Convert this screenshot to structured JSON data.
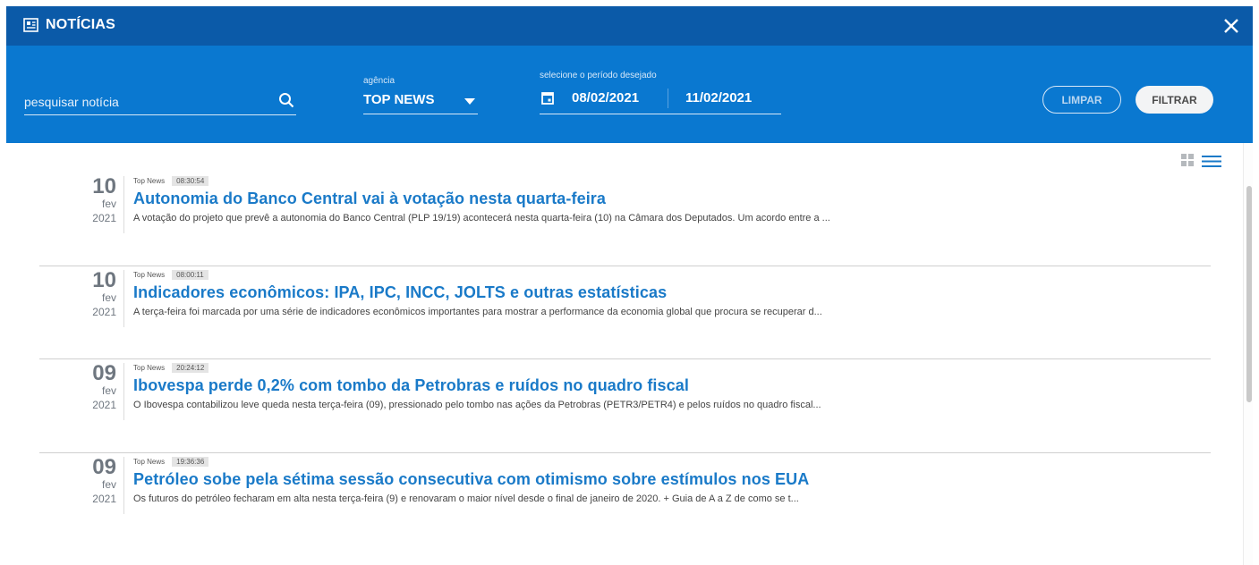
{
  "window": {
    "title": "NOTÍCIAS",
    "title_icon": "newspaper-icon",
    "close_icon": "close-icon"
  },
  "filters": {
    "search": {
      "placeholder": "pesquisar notícia",
      "value": ""
    },
    "agency": {
      "label": "agência",
      "value": "TOP NEWS"
    },
    "period": {
      "label": "selecione o período desejado",
      "start": "08/02/2021",
      "end": "11/02/2021"
    },
    "clear_label": "LIMPAR",
    "filter_label": "FILTRAR"
  },
  "view_toggle": {
    "grid_icon": "grid-view-icon",
    "list_icon": "list-view-icon"
  },
  "colors": {
    "titlebar": "#0b5aa8",
    "filterbar": "#0a78d0",
    "headline": "#1a7ac8"
  },
  "news": [
    {
      "day": "10",
      "month": "fev",
      "year": "2021",
      "agency": "Top News",
      "time": "08:30:54",
      "title": "Autonomia do Banco Central vai à votação nesta quarta-feira",
      "summary": "A votação do projeto que prevê a autonomia do Banco Central (PLP 19/19) acontecerá nesta quarta-feira (10) na Câmara dos Deputados. Um acordo entre a ..."
    },
    {
      "day": "10",
      "month": "fev",
      "year": "2021",
      "agency": "Top News",
      "time": "08:00:11",
      "title": "Indicadores econômicos: IPA, IPC, INCC, JOLTS e outras estatísticas",
      "summary": "A terça-feira foi marcada por uma série de indicadores econômicos importantes para mostrar a performance da economia global que procura se recuperar d..."
    },
    {
      "day": "09",
      "month": "fev",
      "year": "2021",
      "agency": "Top News",
      "time": "20:24:12",
      "title": "Ibovespa perde 0,2% com tombo da Petrobras e ruídos no quadro fiscal",
      "summary": "O Ibovespa contabilizou leve queda nesta terça-feira (09), pressionado pelo tombo nas ações da Petrobras (PETR3/PETR4) e pelos ruídos no quadro fiscal..."
    },
    {
      "day": "09",
      "month": "fev",
      "year": "2021",
      "agency": "Top News",
      "time": "19:36:36",
      "title": "Petróleo sobe pela sétima sessão consecutiva com otimismo sobre estímulos nos EUA",
      "summary": "Os futuros do petróleo fecharam em alta nesta terça-feira (9) e renovaram o maior nível desde o final de janeiro de 2020. + Guia de A a Z de como se t..."
    }
  ]
}
